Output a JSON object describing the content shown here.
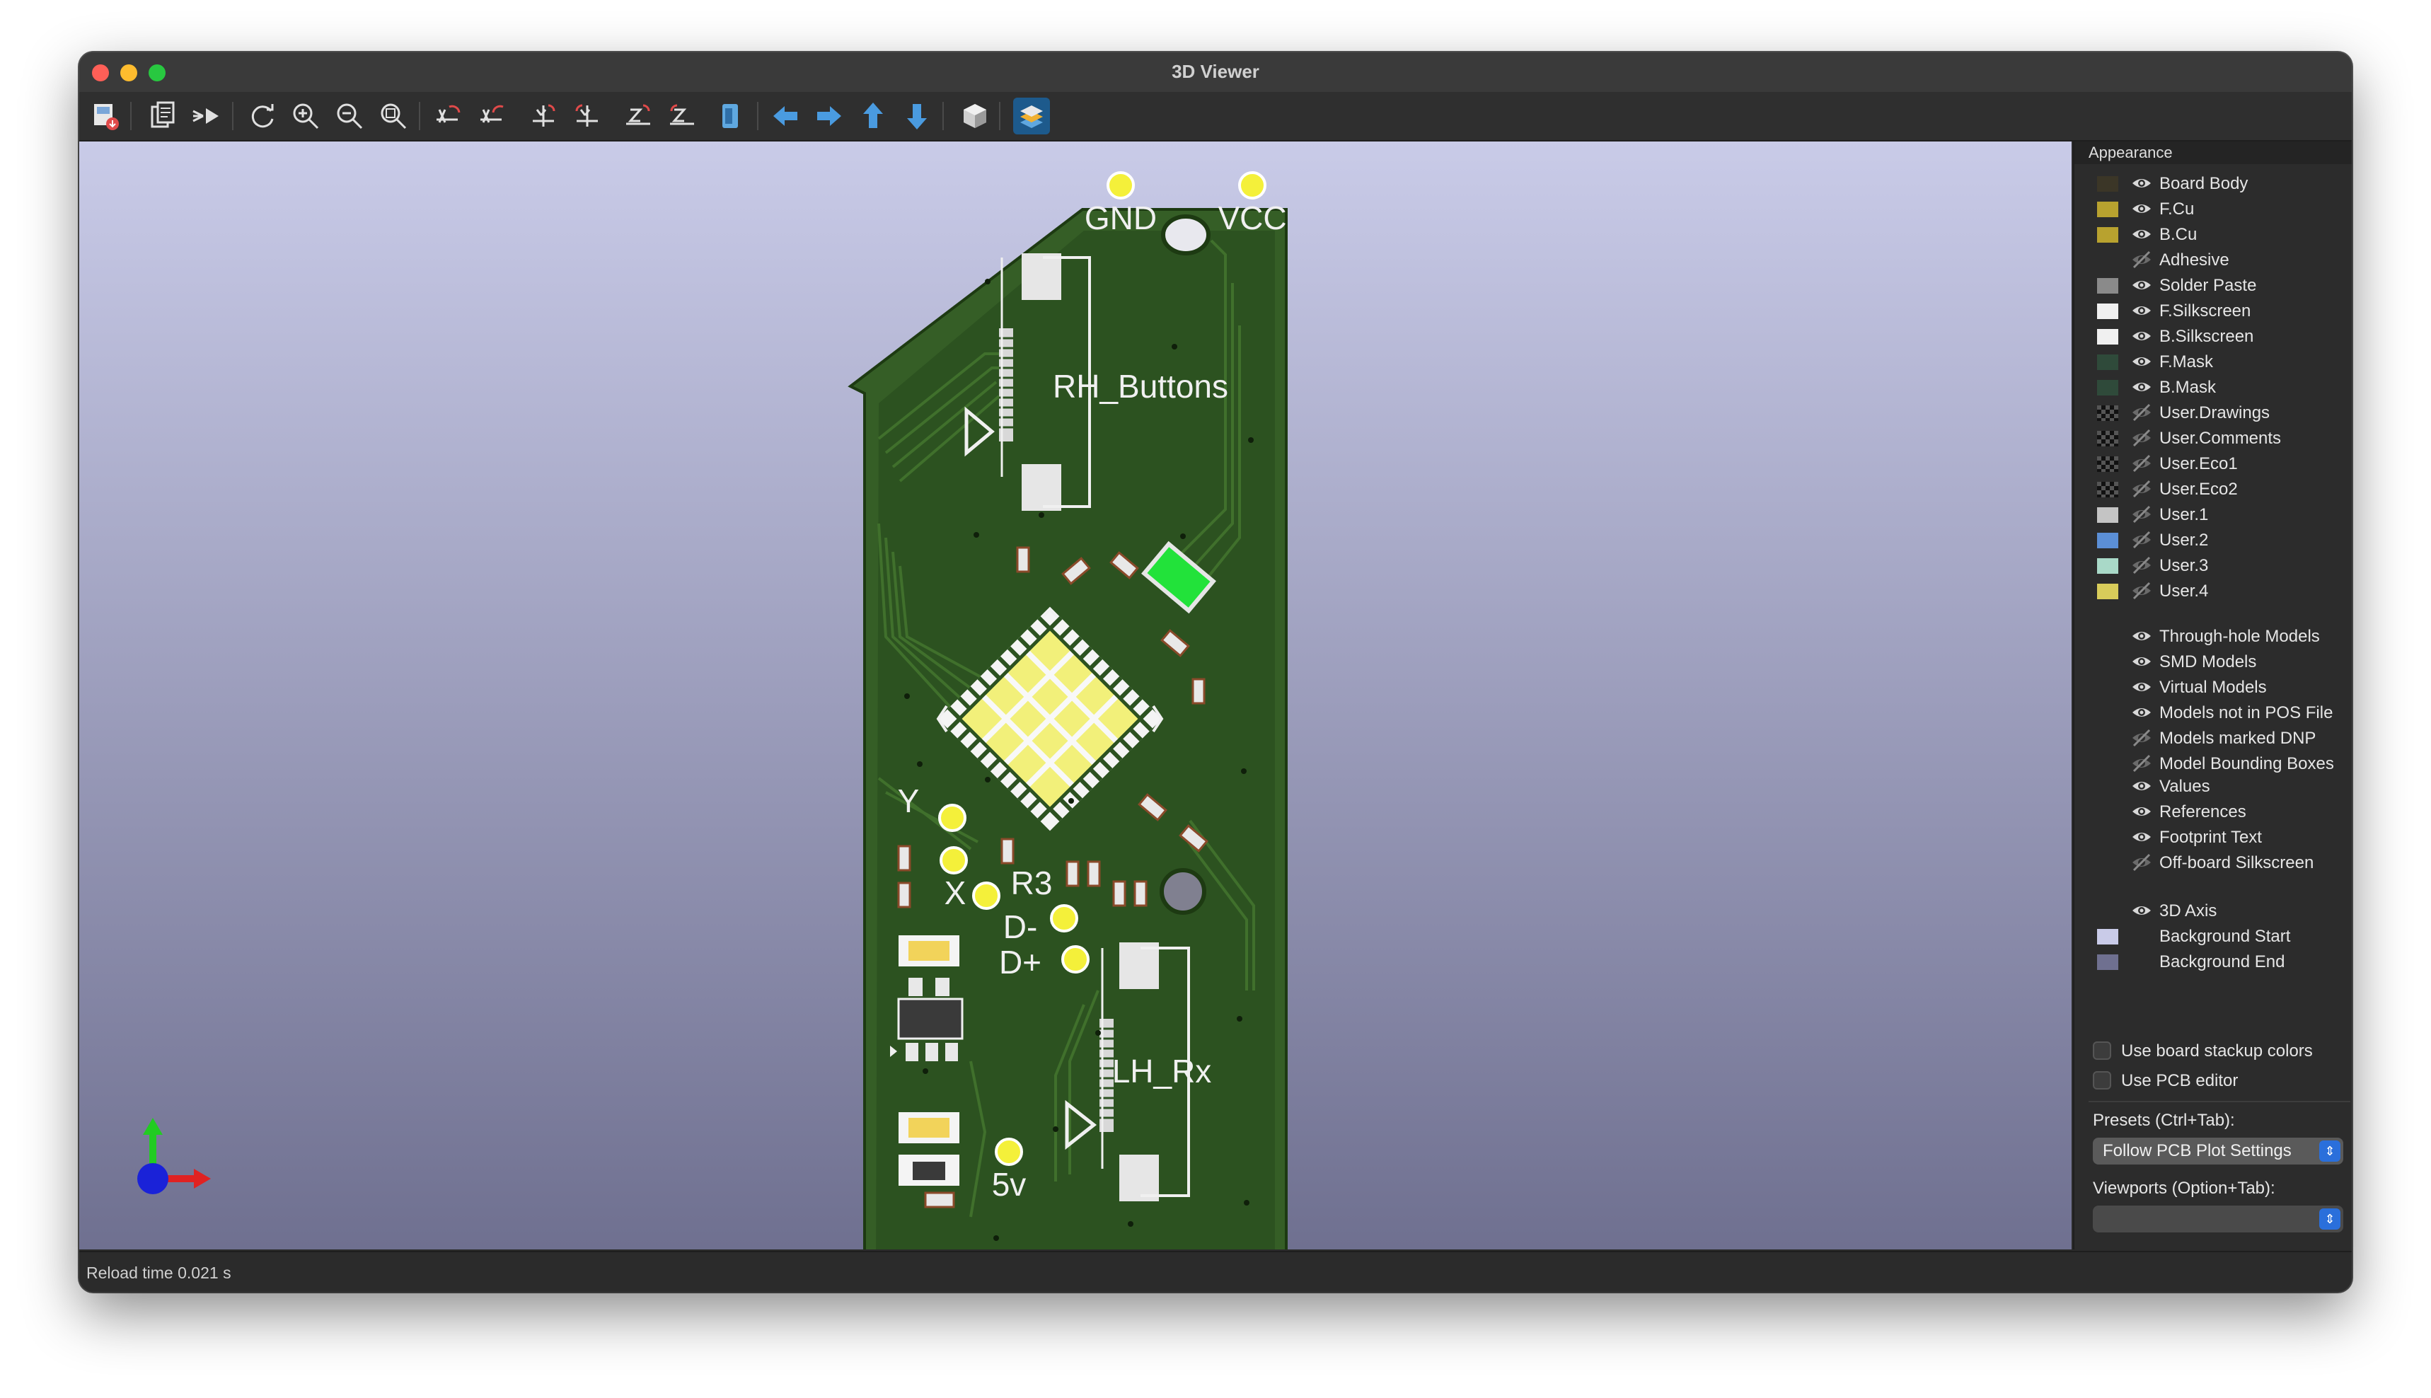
{
  "window": {
    "title": "3D Viewer"
  },
  "toolbar": {
    "buttons": [
      "export-image-icon",
      "copy-icon",
      "raytrace-icon",
      "reload-icon",
      "zoom-in-icon",
      "zoom-out-icon",
      "zoom-fit-icon",
      "rotate-x-cw-icon",
      "rotate-x-ccw-icon",
      "rotate-y-cw-icon",
      "rotate-y-ccw-icon",
      "rotate-z-cw-icon",
      "rotate-z-ccw-icon",
      "flip-board-icon",
      "pan-left-icon",
      "pan-right-icon",
      "pan-up-icon",
      "pan-down-icon",
      "orthographic-icon",
      "layers-manager-icon"
    ]
  },
  "board": {
    "labels": {
      "gnd": "GND",
      "vcc": "VCC",
      "rh": "RH_Buttons",
      "y": "Y",
      "x": "X",
      "r3": "R3",
      "dminus": "D-",
      "dplus": "D+",
      "lh": "LH_Rx",
      "v5": "5v"
    },
    "colors": {
      "board": "#2c5220",
      "silk": "#f0f0f0",
      "pad": "#f4f03a",
      "led": "#22e23a"
    }
  },
  "panel": {
    "header": "Appearance",
    "layers": [
      {
        "label": "Board Body",
        "color": "#3b3627",
        "visible": true
      },
      {
        "label": "F.Cu",
        "color": "#b8a22f",
        "visible": true
      },
      {
        "label": "B.Cu",
        "color": "#b8a22f",
        "visible": true
      },
      {
        "label": "Adhesive",
        "color": "",
        "visible": false
      },
      {
        "label": "Solder Paste",
        "color": "#8a8a8a",
        "visible": true
      },
      {
        "label": "F.Silkscreen",
        "color": "#f0f0f0",
        "visible": true
      },
      {
        "label": "B.Silkscreen",
        "color": "#f0f0f0",
        "visible": true
      },
      {
        "label": "F.Mask",
        "color": "#2f4a3a",
        "visible": true
      },
      {
        "label": "B.Mask",
        "color": "#2f4a3a",
        "visible": true
      },
      {
        "label": "User.Drawings",
        "color": "checker",
        "visible": false
      },
      {
        "label": "User.Comments",
        "color": "checker",
        "visible": false
      },
      {
        "label": "User.Eco1",
        "color": "checker",
        "visible": false
      },
      {
        "label": "User.Eco2",
        "color": "checker",
        "visible": false
      },
      {
        "label": "User.1",
        "color": "#c4c4c4",
        "visible": false
      },
      {
        "label": "User.2",
        "color": "#5b8fd6",
        "visible": false
      },
      {
        "label": "User.3",
        "color": "#a9d9c8",
        "visible": false
      },
      {
        "label": "User.4",
        "color": "#d8cc5a",
        "visible": false
      }
    ],
    "models": [
      {
        "label": "Through-hole Models",
        "visible": true
      },
      {
        "label": "SMD Models",
        "visible": true
      },
      {
        "label": "Virtual Models",
        "visible": true
      },
      {
        "label": "Models not in POS File",
        "visible": true
      },
      {
        "label": "Models marked DNP",
        "visible": false
      },
      {
        "label": "Model Bounding Boxes",
        "visible": false
      }
    ],
    "texts": [
      {
        "label": "Values",
        "visible": true
      },
      {
        "label": "References",
        "visible": true
      },
      {
        "label": "Footprint Text",
        "visible": true
      },
      {
        "label": "Off-board Silkscreen",
        "visible": false
      }
    ],
    "misc": [
      {
        "label": "3D Axis",
        "color": "",
        "visible": true
      },
      {
        "label": "Background Start",
        "color": "#c9cbe8",
        "visible": null
      },
      {
        "label": "Background End",
        "color": "#6f7090",
        "visible": null
      }
    ],
    "use_stackup": "Use board stackup colors",
    "use_pcb_editor": "Use PCB editor",
    "presets_label": "Presets (Ctrl+Tab):",
    "presets_value": "Follow PCB Plot Settings",
    "viewports_label": "Viewports (Option+Tab):",
    "viewports_value": ""
  },
  "status": {
    "text": "Reload time 0.021 s"
  }
}
